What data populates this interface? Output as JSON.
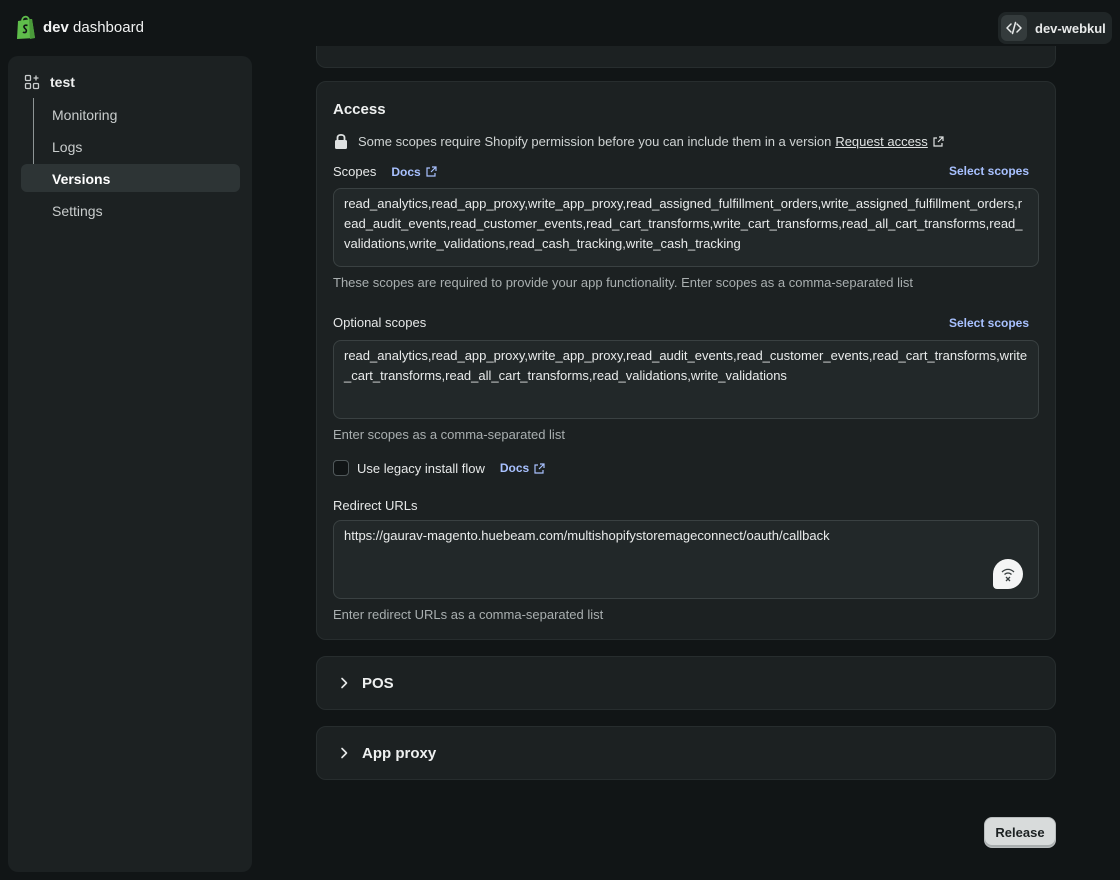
{
  "topbar": {
    "brand_bold": "dev",
    "brand_rest": " dashboard",
    "account_name": "dev-webkul",
    "logo_icon": "shopify-bag-icon",
    "account_icon": "code-icon"
  },
  "sidebar": {
    "app_name": "test",
    "app_icon": "apps-grid-icon",
    "items": [
      {
        "label": "Monitoring",
        "active": false
      },
      {
        "label": "Logs",
        "active": false
      },
      {
        "label": "Versions",
        "active": true
      },
      {
        "label": "Settings",
        "active": false
      }
    ]
  },
  "access": {
    "heading": "Access",
    "notice": "Some scopes require Shopify permission before you can include them in a version",
    "request_access": "Request access",
    "scopes_label": "Scopes",
    "docs_label": "Docs",
    "select_scopes": "Select scopes",
    "scopes_value": "read_analytics,read_app_proxy,write_app_proxy,read_assigned_fulfillment_orders,write_assigned_fulfillment_orders,read_audit_events,read_customer_events,read_cart_transforms,write_cart_transforms,read_all_cart_transforms,read_validations,write_validations,read_cash_tracking,write_cash_tracking",
    "scopes_help": "These scopes are required to provide your app functionality. Enter scopes as a comma-separated list",
    "optional_label": "Optional scopes",
    "optional_select_scopes": "Select scopes",
    "optional_value": "read_analytics,read_app_proxy,write_app_proxy,read_audit_events,read_customer_events,read_cart_transforms,write_cart_transforms,read_all_cart_transforms,read_validations,write_validations",
    "optional_help": "Enter scopes as a comma-separated list",
    "legacy_label": "Use legacy install flow",
    "legacy_docs": "Docs",
    "legacy_checked": false,
    "redirect_label": "Redirect URLs",
    "redirect_value": "https://gaurav-magento.huebeam.com/multishopifystoremageconnect/oauth/callback",
    "redirect_help": "Enter redirect URLs as a comma-separated list"
  },
  "sections": [
    {
      "title": "POS",
      "expanded": false
    },
    {
      "title": "App proxy",
      "expanded": false
    }
  ],
  "footer": {
    "release_label": "Release"
  },
  "colors": {
    "background": "#111516",
    "card": "#1c2122",
    "link": "#a8c1ff",
    "brand_green": "#5fbd4b"
  }
}
